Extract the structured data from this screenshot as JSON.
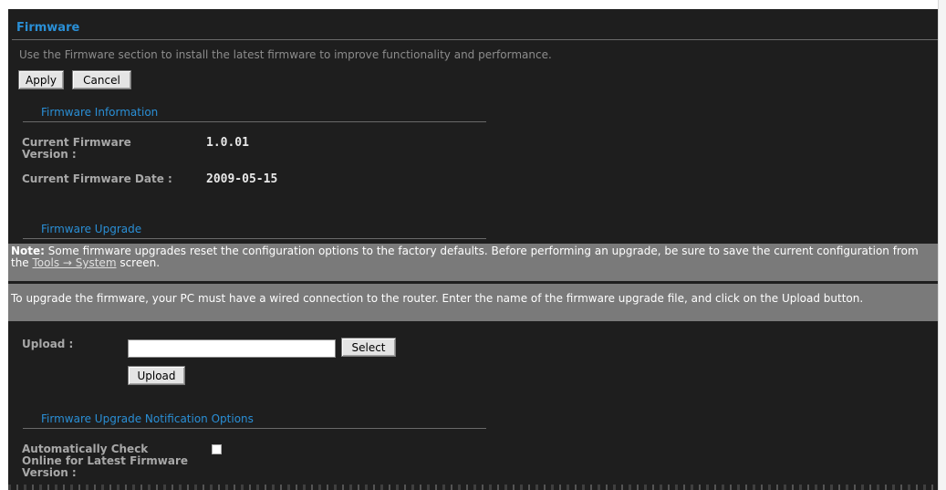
{
  "page": {
    "title": "Firmware",
    "description": "Use the Firmware section to install the latest firmware to improve functionality and performance."
  },
  "actions": {
    "apply_label": "Apply",
    "cancel_label": "Cancel"
  },
  "info_section": {
    "heading": "Firmware Information",
    "current_version_label_line1": "Current Firmware",
    "current_version_label_line2": "Version :",
    "current_version_value": "1.0.01",
    "current_date_label": "Current Firmware Date :",
    "current_date_value": "2009-05-15"
  },
  "upgrade_section": {
    "heading": "Firmware Upgrade",
    "note_prefix": "Note:",
    "note_text": " Some firmware upgrades reset the configuration options to the factory defaults. Before performing an upgrade, be sure to save the current configuration from the ",
    "note_link": "Tools → System",
    "note_suffix": " screen.",
    "instructions": "To upgrade the firmware, your PC must have a wired connection to the router. Enter the name of the firmware upgrade file, and click on the Upload button.",
    "upload_label": "Upload :",
    "upload_value": "",
    "select_label": "Select",
    "upload_button_label": "Upload"
  },
  "notification_section": {
    "heading": "Firmware Upgrade Notification Options",
    "auto_check_label_line1": "Automatically Check",
    "auto_check_label_line2": "Online for Latest Firmware",
    "auto_check_label_line3": "Version :",
    "auto_check_checked": false
  },
  "colors": {
    "background": "#1e1e1e",
    "accent": "#2a8fd6",
    "note_bar": "#7a7a7a"
  }
}
